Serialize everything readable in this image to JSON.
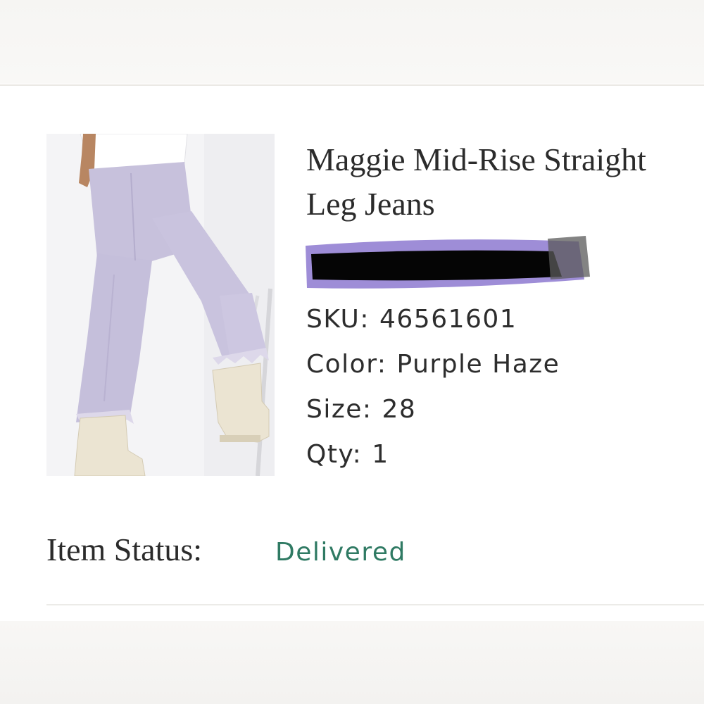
{
  "product": {
    "title_line1": "Maggie Mid-Rise Straight",
    "title_line2": "Leg Jeans",
    "sku_label": "SKU:",
    "sku_value": "46561601",
    "color_label": "Color:",
    "color_value": "Purple Haze",
    "size_label": "Size:",
    "size_value": "28",
    "qty_label": "Qty:",
    "qty_value": "1"
  },
  "status": {
    "label": "Item Status:",
    "value": "Delivered"
  },
  "colors": {
    "status_accent": "#2f7a63",
    "redaction_scribble": "#000000",
    "redaction_halo": "#7d67c9"
  }
}
